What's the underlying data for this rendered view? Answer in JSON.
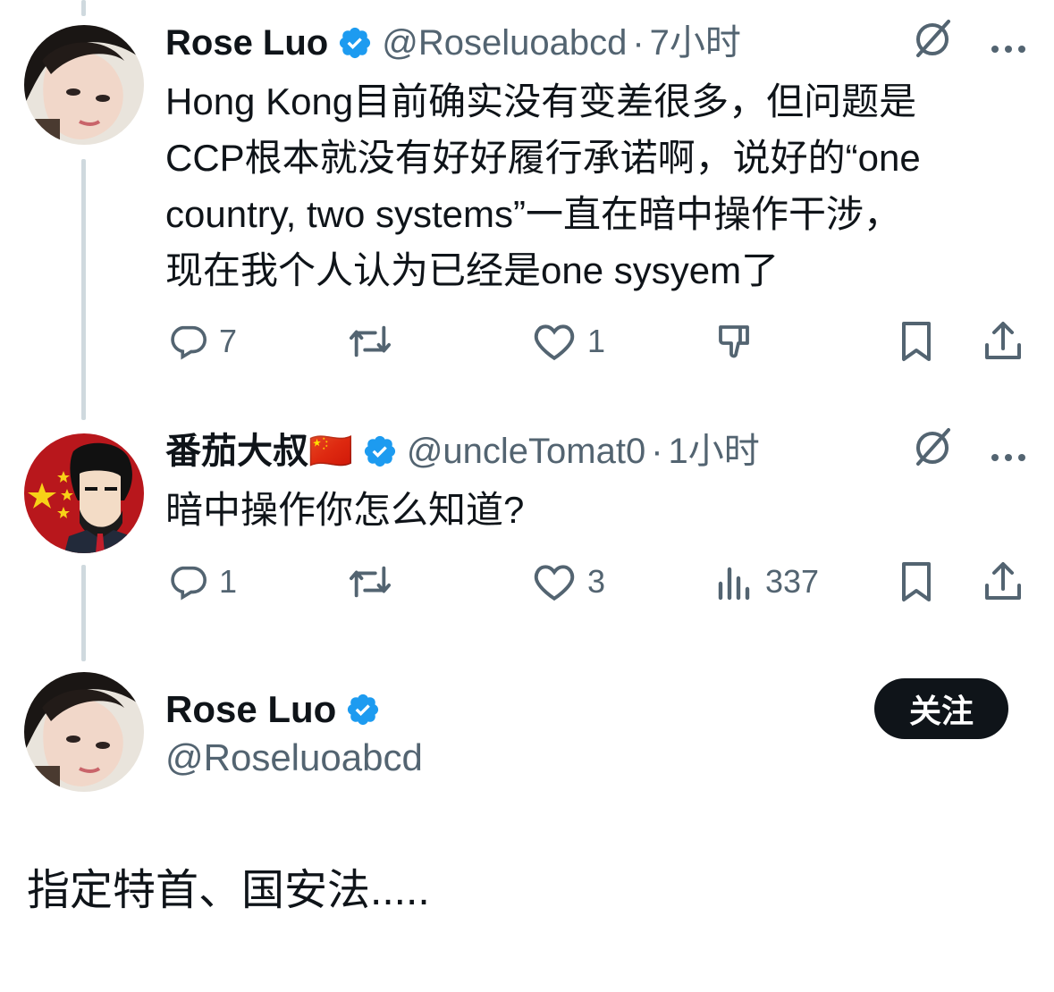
{
  "tweets": [
    {
      "author_name": "Rose Luo",
      "handle": "@Roseluoabcd",
      "separator": "·",
      "time": "7小时",
      "text": "Hong Kong目前确实没有变差很多，但问题是\nCCP根本就没有好好履行承诺啊，说好的“one\ncountry, two systems”一直在暗中操作干涉，\n现在我个人认为已经是one sysyem了",
      "actions": {
        "reply_count": "7",
        "like_count": "1"
      }
    },
    {
      "author_name": "番茄大叔🇨🇳",
      "handle": "@uncleTomat0",
      "separator": "·",
      "time": "1小时",
      "text": "暗中操作你怎么知道?",
      "actions": {
        "reply_count": "1",
        "like_count": "3",
        "view_count": "337"
      }
    }
  ],
  "main_tweet": {
    "author_name": "Rose Luo",
    "handle": "@Roseluoabcd",
    "follow_label": "关注",
    "text": "指定特首、国安法....."
  },
  "colors": {
    "verified": "#1d9bf0",
    "secondary_text": "#536471",
    "thread_line": "#cfd9de",
    "follow_bg": "#0f1419"
  },
  "icons": [
    "verified-badge-icon",
    "grok-icon",
    "more-icon",
    "reply-icon",
    "retweet-icon",
    "like-icon",
    "dislike-icon",
    "views-icon",
    "bookmark-icon",
    "share-icon"
  ]
}
